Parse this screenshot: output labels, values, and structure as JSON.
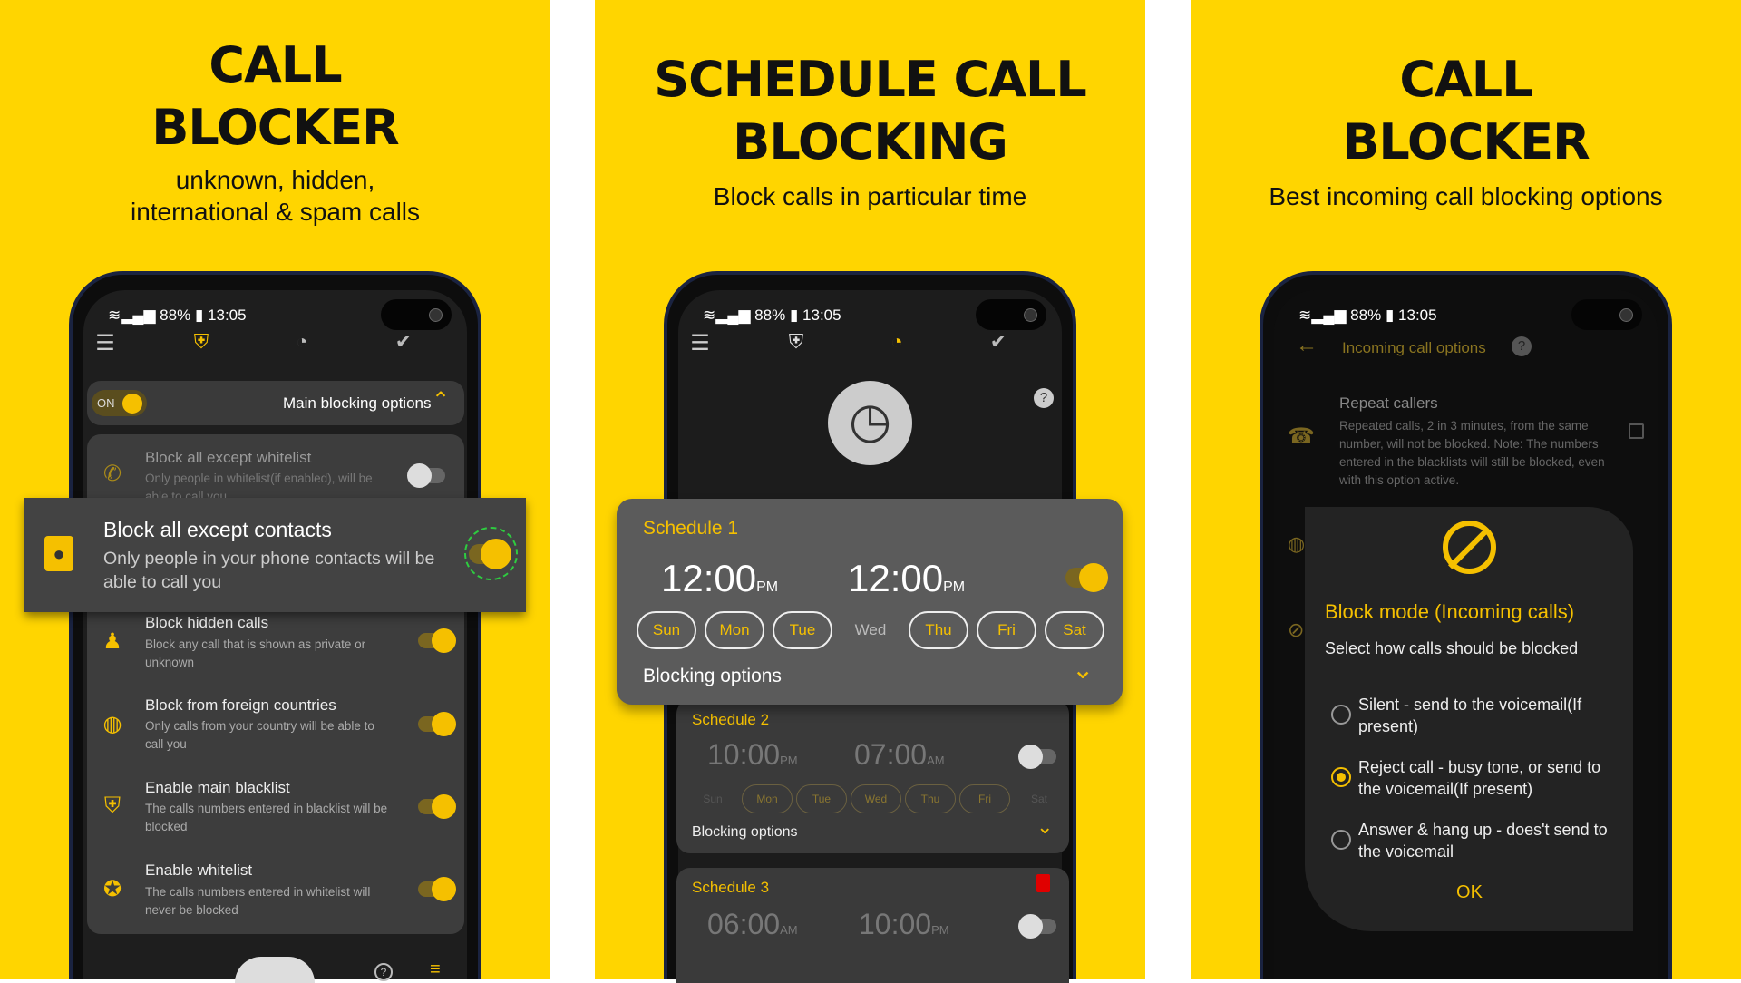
{
  "colors": {
    "background": "#FFD500",
    "accent": "#F5C000",
    "card": "#3d3d3d",
    "danger": "#E00000"
  },
  "status": {
    "battery": "88%",
    "time": "13:05"
  },
  "panel1": {
    "title_line1": "CALL",
    "title_line2": "BLOCKER",
    "subtitle_line1": "unknown, hidden,",
    "subtitle_line2": "international & spam calls",
    "main_toggle": "ON",
    "main_header": "Main blocking options",
    "items": [
      {
        "title": "Block all except whitelist",
        "desc": "Only people in whitelist(if enabled), will be able to call you",
        "enabled": false,
        "icon": "phone-lock-icon"
      },
      {
        "title": "Block all except contacts",
        "desc": "Only people in your phone contacts will be able to call you",
        "enabled": true,
        "icon": "contacts-book-icon"
      },
      {
        "title": "Block hidden calls",
        "desc": "Block any call that is shown as private or unknown",
        "enabled": true,
        "icon": "incognito-icon"
      },
      {
        "title": "Block from foreign countries",
        "desc": "Only calls from your country will be able to call you",
        "enabled": true,
        "icon": "globe-block-icon"
      },
      {
        "title": "Enable main blacklist",
        "desc": "The calls numbers entered in blacklist will be blocked",
        "enabled": true,
        "icon": "shield-icon"
      },
      {
        "title": "Enable whitelist",
        "desc": "The calls numbers entered in whitelist will never be blocked",
        "enabled": true,
        "icon": "star-icon"
      }
    ],
    "help": "?"
  },
  "panel2": {
    "title_line1": "SCHEDULE CALL",
    "title_line2": "BLOCKING",
    "subtitle": "Block calls in particular time",
    "help": "?",
    "blocking_options": "Blocking options",
    "schedules": [
      {
        "name": "Schedule 1",
        "start": "12:00",
        "start_ampm": "PM",
        "end": "12:00",
        "end_ampm": "PM",
        "enabled": true,
        "days": [
          {
            "d": "Sun",
            "on": true
          },
          {
            "d": "Mon",
            "on": true
          },
          {
            "d": "Tue",
            "on": true
          },
          {
            "d": "Wed",
            "on": false
          },
          {
            "d": "Thu",
            "on": true
          },
          {
            "d": "Fri",
            "on": true
          },
          {
            "d": "Sat",
            "on": true
          }
        ]
      },
      {
        "name": "Schedule 2",
        "start": "10:00",
        "start_ampm": "PM",
        "end": "07:00",
        "end_ampm": "AM",
        "enabled": false,
        "days": [
          {
            "d": "Sun",
            "on": false
          },
          {
            "d": "Mon",
            "on": true
          },
          {
            "d": "Tue",
            "on": true
          },
          {
            "d": "Wed",
            "on": true
          },
          {
            "d": "Thu",
            "on": true
          },
          {
            "d": "Fri",
            "on": true
          },
          {
            "d": "Sat",
            "on": false
          }
        ]
      },
      {
        "name": "Schedule 3",
        "start": "06:00",
        "start_ampm": "AM",
        "end": "10:00",
        "end_ampm": "PM",
        "enabled": false
      }
    ]
  },
  "panel3": {
    "title_line1": "CALL",
    "title_line2": "BLOCKER",
    "subtitle": "Best incoming call blocking options",
    "header": "Incoming call options",
    "help": "?",
    "repeat_title": "Repeat callers",
    "repeat_desc": "Repeated calls, 2 in 3 minutes, from the same number, will not be blocked. Note: The numbers entered in the blacklists will still be blocked, even with this option active.",
    "repeat_checked": false,
    "dialog": {
      "title": "Block mode (Incoming calls)",
      "subtitle": "Select how calls should be blocked",
      "options": [
        "Silent - send to the voicemail(If present)",
        "Reject call - busy tone, or send to the voicemail(If present)",
        "Answer & hang up - does't send to the voicemail"
      ],
      "selected": 1,
      "ok": "OK"
    }
  }
}
